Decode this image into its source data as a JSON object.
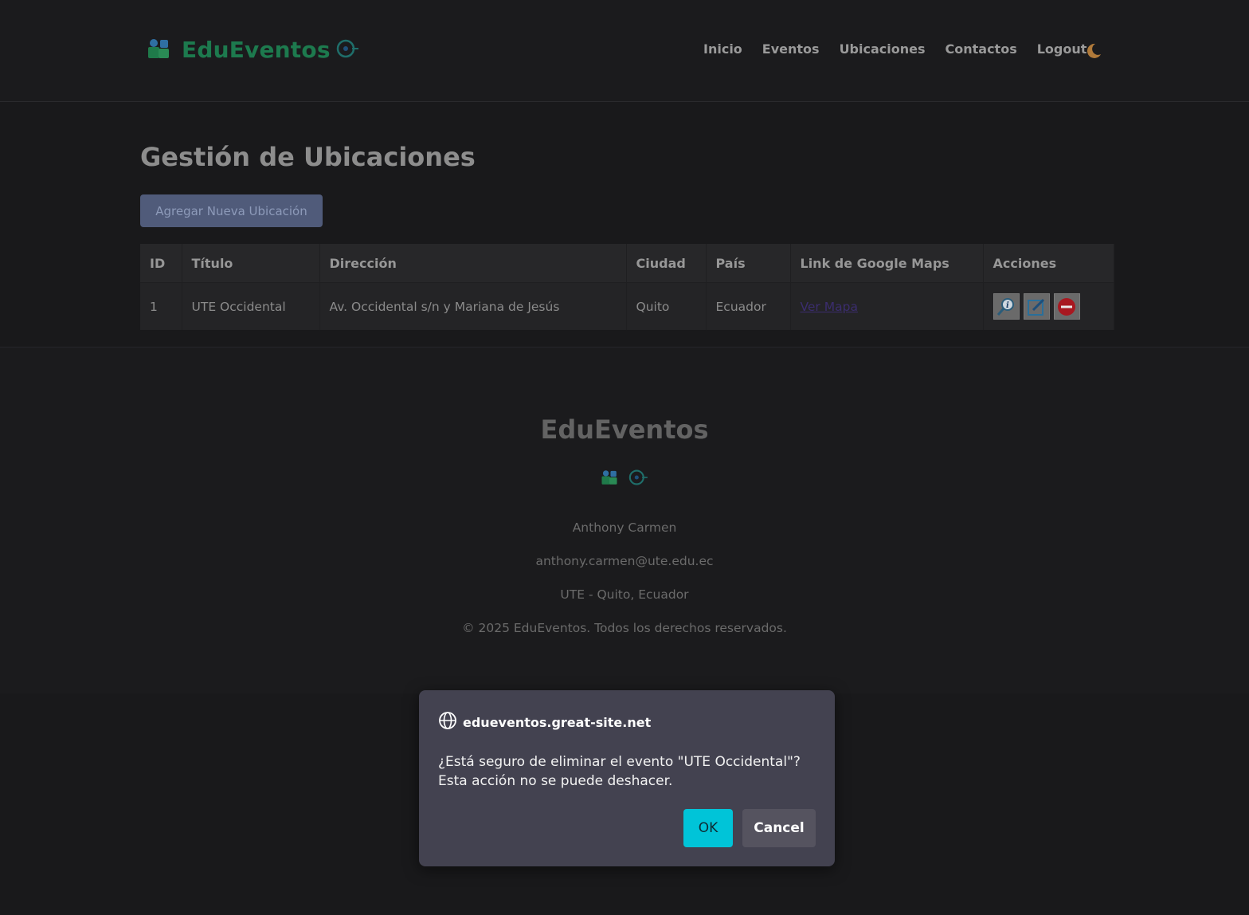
{
  "header": {
    "brand_name": "EduEventos",
    "nav": [
      "Inicio",
      "Eventos",
      "Ubicaciones",
      "Contactos",
      "Logout"
    ],
    "theme_toggle_icon": "moon-icon"
  },
  "main": {
    "title": "Gestión de Ubicaciones",
    "add_button": "Agregar Nueva Ubicación",
    "table": {
      "headers": [
        "ID",
        "Título",
        "Dirección",
        "Ciudad",
        "País",
        "Link de Google Maps",
        "Acciones"
      ],
      "rows": [
        {
          "id": "1",
          "titulo": "UTE Occidental",
          "direccion": "Av. Occidental s/n y Mariana de Jesús",
          "ciudad": "Quito",
          "pais": "Ecuador",
          "link": "Ver Mapa",
          "actions": [
            "view-icon",
            "edit-icon",
            "delete-icon"
          ]
        }
      ]
    }
  },
  "footer": {
    "title": "EduEventos",
    "name": "Anthony Carmen",
    "email": "anthony.carmen@ute.edu.ec",
    "location": "UTE - Quito, Ecuador",
    "copyright": "© 2025 EduEventos. Todos los derechos reservados."
  },
  "dialog": {
    "origin": "edueventos.great-site.net",
    "message": "¿Está seguro de eliminar el evento \"UTE Occidental\"? Esta acción no se puede deshacer.",
    "ok": "OK",
    "cancel": "Cancel"
  },
  "colors": {
    "brand": "#1d7a4e",
    "dialog_bg": "#434250",
    "ok_button": "#00c4d8"
  }
}
